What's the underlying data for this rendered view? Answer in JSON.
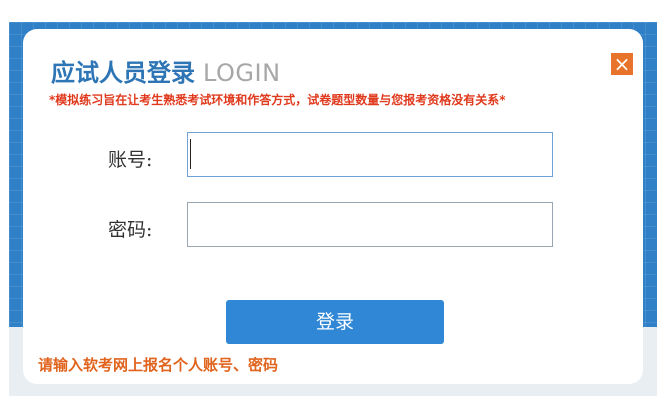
{
  "dialog": {
    "title": "应试人员登录",
    "title_en": "LOGIN",
    "close_symbol": "×",
    "notice": "*模拟练习旨在让考生熟悉考试环境和作答方式，试卷题型数量与您报考资格没有关系*"
  },
  "form": {
    "account_label": "账号:",
    "account_value": "",
    "password_label": "密码:",
    "password_value": ""
  },
  "login_button": "登录",
  "hint": "请输入软考网上报名个人账号、密码",
  "colors": {
    "title": "#2e75b6",
    "notice": "#e03a1e",
    "close": "#e8732a",
    "button": "#2f87d6",
    "hint": "#e0641e",
    "backdrop": "#2f80c7"
  },
  "icons": {
    "close": "close-icon"
  }
}
